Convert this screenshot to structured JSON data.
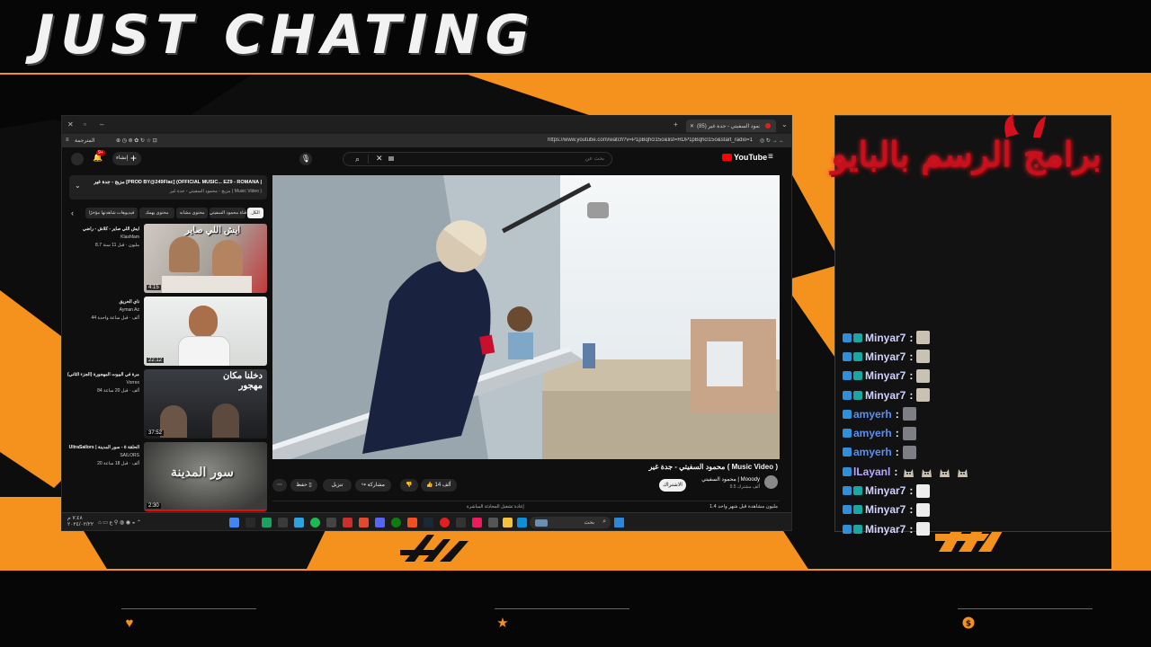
{
  "overlay": {
    "title": "JUST CHATING",
    "accent": "#f5921e",
    "bottom_icons": [
      "heart-icon",
      "star-icon",
      "dollar-icon"
    ],
    "chat_banner_text": "برامج الرسم بالبايو"
  },
  "browser": {
    "tab_title": "محمود السفيتي - جدة غير (85)",
    "url": "https://www.youtube.com/watch?v=P1pBqhcl15o&list=RDP1pBqhcl15o&start_radio=1",
    "bookmark": "المترجمة"
  },
  "youtube": {
    "logo": "YouTube",
    "search_placeholder": "بحث عن",
    "create_label": "إنشاء",
    "notification_count": "9+",
    "video_title": "محمود السفيتي - جدة غير ( Music Video )",
    "channel_name": "محمود السفيتي | Mooody",
    "subscribers": "9.5 ألف مشترك",
    "subscribe_label": "الاشتراك",
    "like_count": "14 ألف",
    "share_label": "مشاركة",
    "download_label": "تنزيل",
    "save_label": "حفظ",
    "views_line": "1.4 مليون مشاهدة قبل شهر واحد",
    "live_chat_note": "إعادة تشغيل المحادثة المباشرة",
    "playlist_title": "مزيج - جدة غير [PROD BY@249Flac] (OFFICIAL MUSIC... EZ9 - ROMANA |",
    "playlist_sub": "مزيج - محمود السفيتي - جدة غير ( Music Video )",
    "chips": [
      "الكل",
      "من قناة محمود السفيتي",
      "محتوى مشابه",
      "محتوى يهمك",
      "فيديوهات شاهدتها مؤخرًا"
    ],
    "recommendations": [
      {
        "title": "ايش اللي صاير - كلاش - راضي",
        "channel": "Klashfam",
        "meta": "8.7 مليون · قبل 11 سنة",
        "duration": "4:15",
        "thumb_text": "ايش اللي صاير"
      },
      {
        "title": "ناي الحريق",
        "channel": "Ayman Az",
        "meta": "44 ألف · قبل ساعة واحدة",
        "duration": "22:12",
        "thumb_text": ""
      },
      {
        "title": "مغامرة في البيوت المهجورة (الجزء الثاني)",
        "channel": "Vorrex",
        "meta": "84 ألف · قبل 20 ساعة",
        "duration": "37:52",
        "thumb_text": "دخلنا مكان مهجور"
      },
      {
        "title": "UltraSailors | الحلقة ٥ - سور المدينة",
        "channel": "SAILORS",
        "meta": "20 ألف · قبل 18 ساعة",
        "duration": "2:30",
        "thumb_text": "سور المدينة"
      }
    ]
  },
  "taskbar": {
    "search_label": "بحث",
    "time": "٧:٤٨ م",
    "date": "٢٠٢٤/٠٢/٢٢"
  },
  "chat": {
    "messages": [
      {
        "user": "Minyar7",
        "emote": "emote-face"
      },
      {
        "user": "Minyar7",
        "emote": "emote-face"
      },
      {
        "user": "Minyar7",
        "emote": "emote-face"
      },
      {
        "user": "Minyar7",
        "emote": "emote-face"
      },
      {
        "user": "amyerh",
        "emote": "emote-dark"
      },
      {
        "user": "amyerh",
        "emote": "emote-dark"
      },
      {
        "user": "amyerh",
        "emote": "emote-dark"
      },
      {
        "user": "lLayanl",
        "emote": "emote-cats"
      },
      {
        "user": "Minyar7",
        "emote": "emote-light"
      },
      {
        "user": "Minyar7",
        "emote": "emote-light"
      },
      {
        "user": "Minyar7",
        "emote": "emote-light"
      }
    ],
    "separator": ":"
  }
}
